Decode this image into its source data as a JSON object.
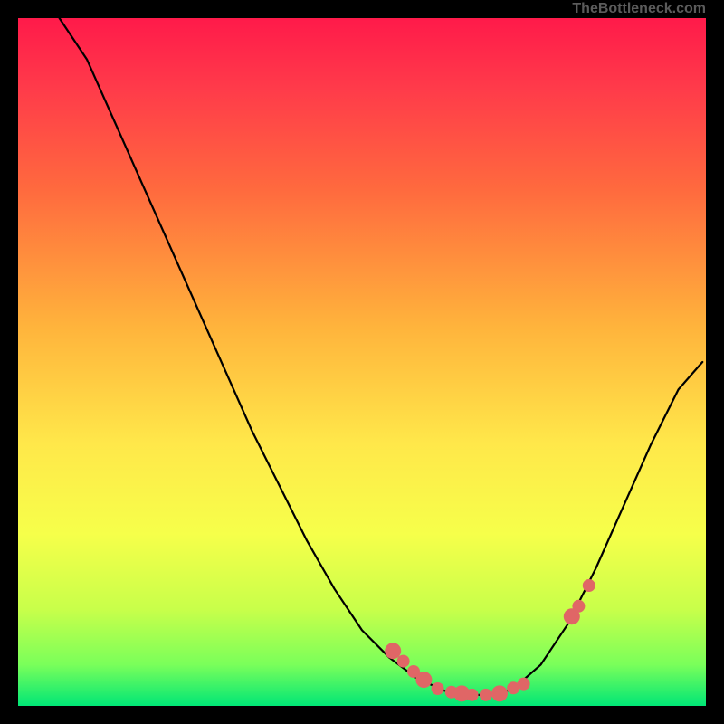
{
  "watermark": "TheBottleneck.com",
  "chart_data": {
    "type": "line",
    "title": "",
    "xlabel": "",
    "ylabel": "",
    "xlim": [
      0,
      100
    ],
    "ylim": [
      0,
      100
    ],
    "series": [
      {
        "name": "curve",
        "x": [
          6,
          10,
          14,
          18,
          22,
          26,
          30,
          34,
          38,
          42,
          46,
          50,
          54,
          58,
          62,
          64,
          66,
          68,
          70,
          72,
          76,
          80,
          84,
          88,
          92,
          96,
          99.5
        ],
        "y": [
          100,
          94,
          85,
          76,
          67,
          58,
          49,
          40,
          32,
          24,
          17,
          11,
          7,
          4,
          2.2,
          1.8,
          1.6,
          1.6,
          1.8,
          2.5,
          6,
          12,
          20,
          29,
          38,
          46,
          50
        ]
      }
    ],
    "scatter_points": {
      "name": "highlighted_points",
      "x": [
        54.5,
        56,
        57.5,
        59,
        61,
        63,
        64.5,
        66,
        68,
        70,
        72,
        73.5,
        80.5,
        81.5,
        83
      ],
      "y": [
        8.0,
        6.5,
        5.0,
        3.8,
        2.5,
        2.0,
        1.8,
        1.6,
        1.6,
        1.8,
        2.6,
        3.2,
        13.0,
        14.5,
        17.5
      ]
    }
  }
}
